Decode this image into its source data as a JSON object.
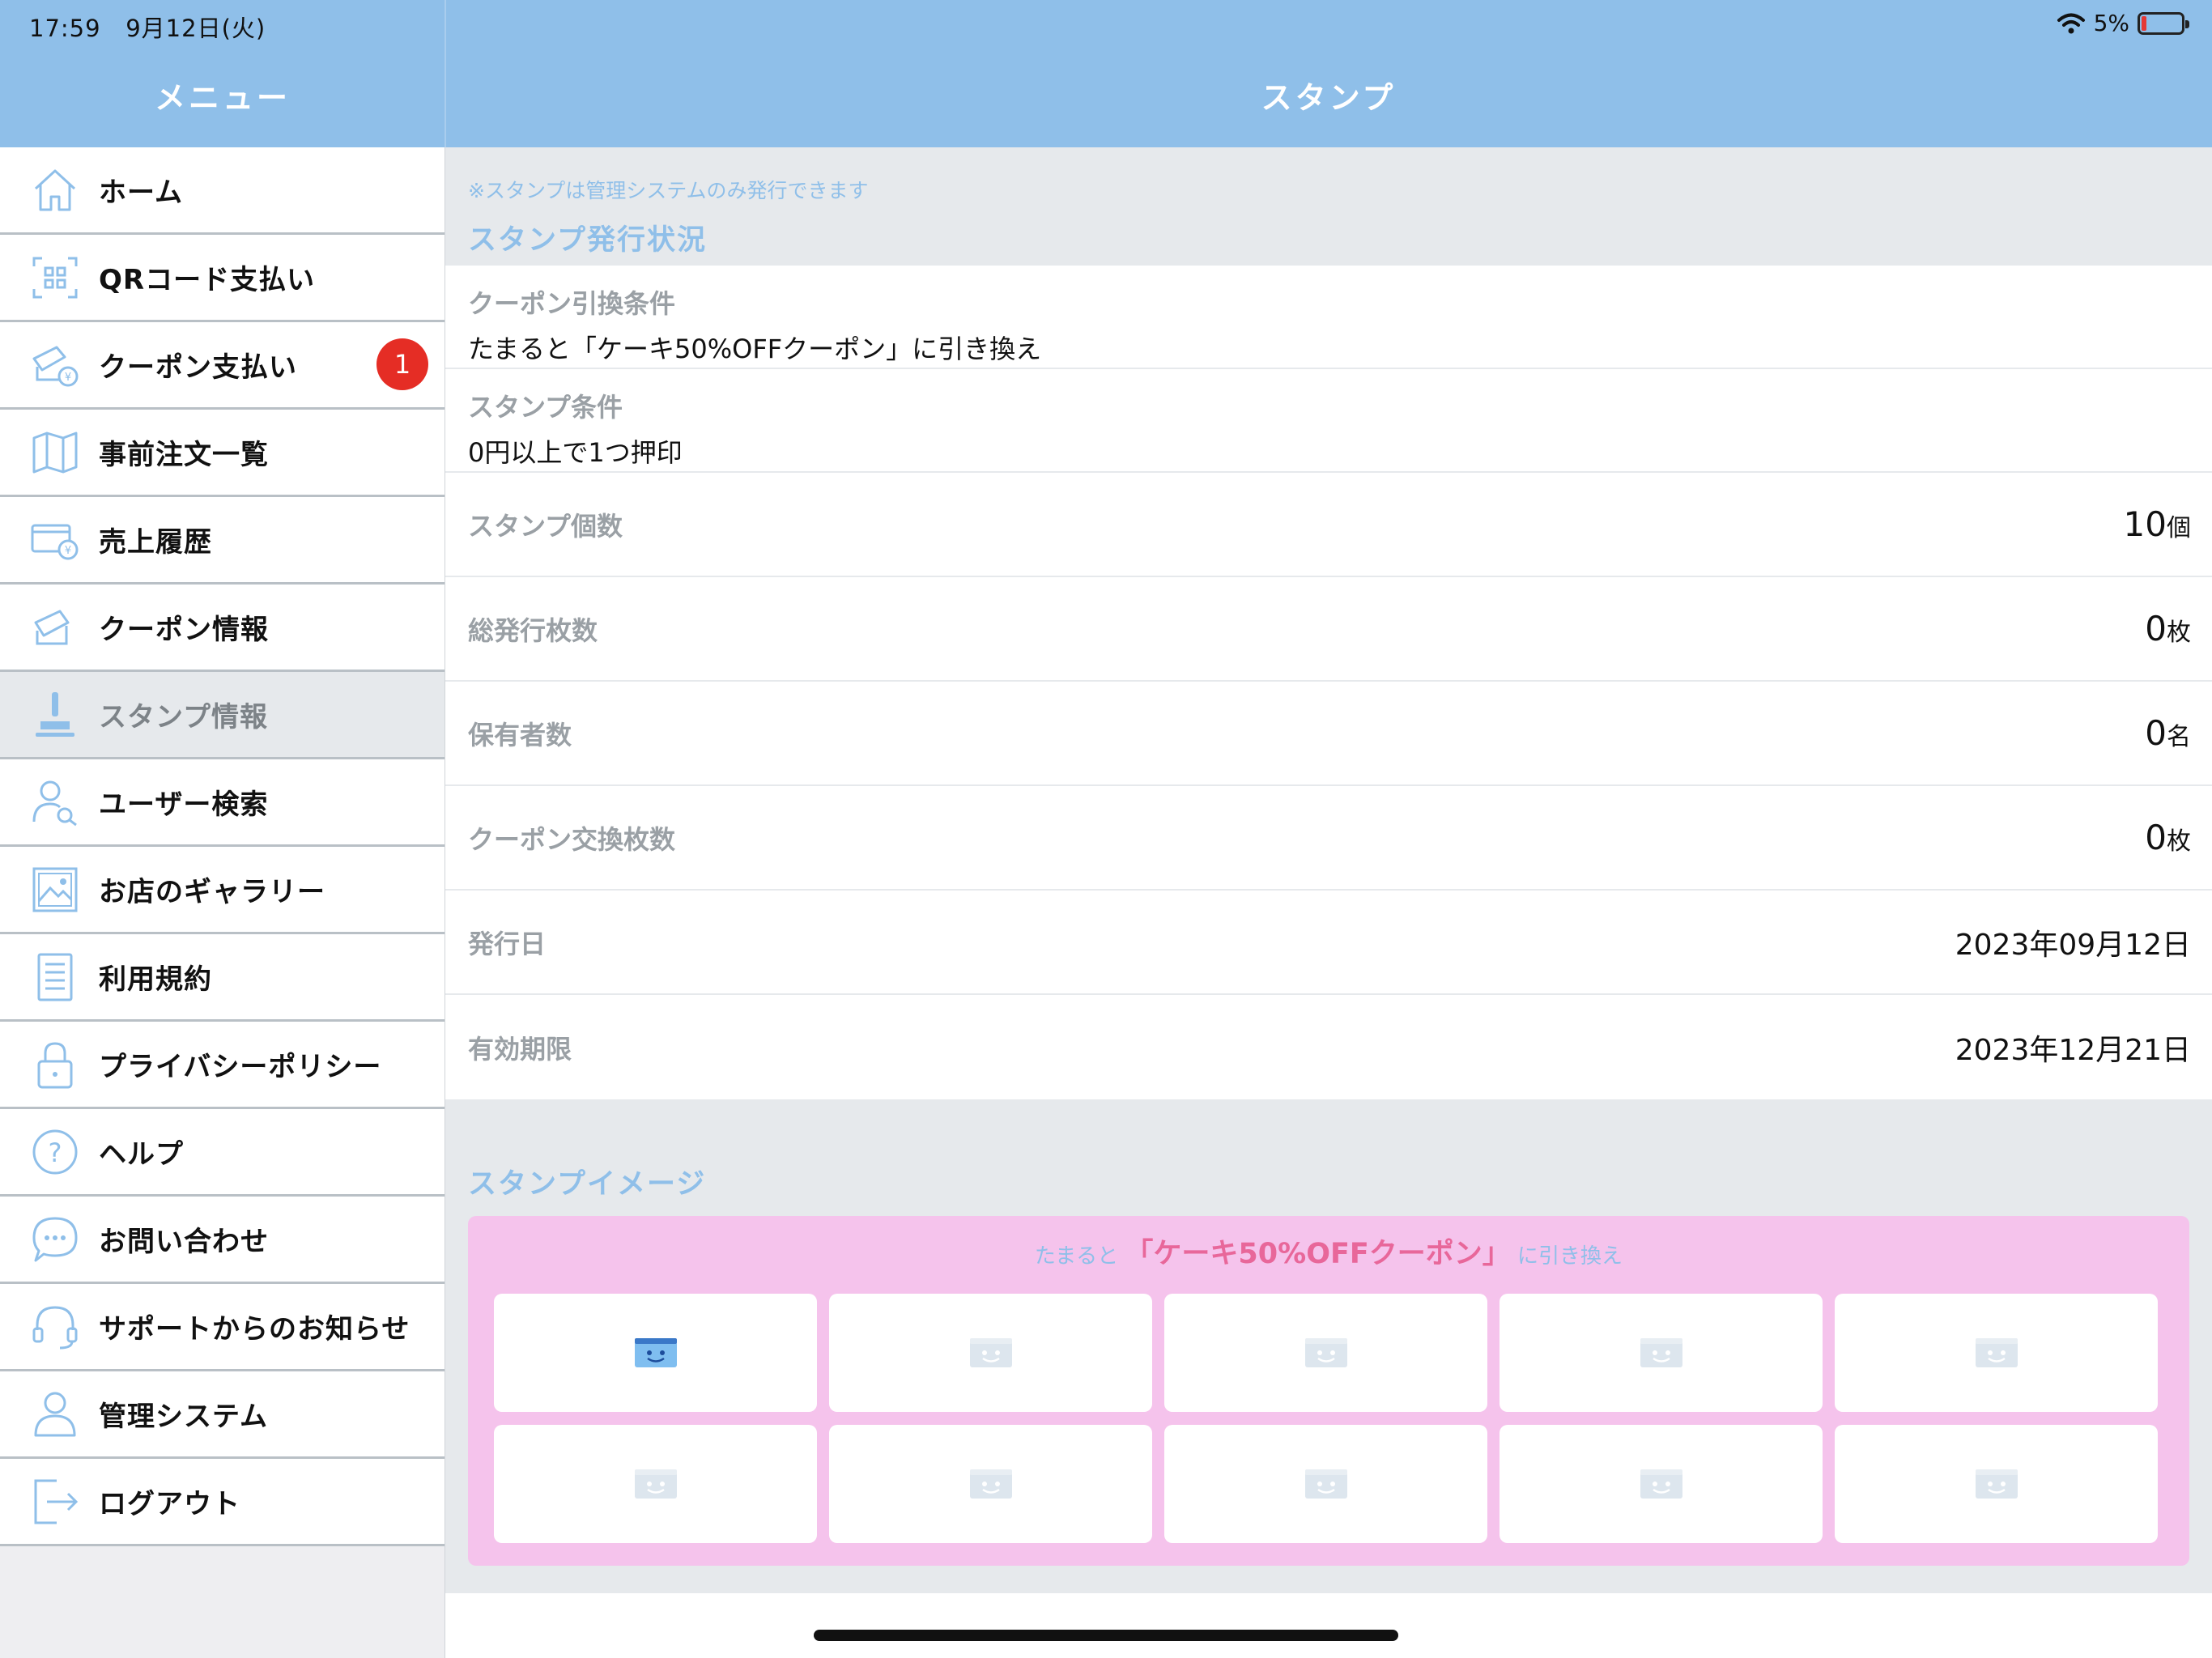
{
  "status_bar": {
    "time": "17:59",
    "date": "9月12日(火)",
    "battery": "5%"
  },
  "sidebar": {
    "title": "メニュー",
    "items": [
      {
        "label": "ホーム",
        "icon": "home-icon"
      },
      {
        "label": "QRコード支払い",
        "icon": "qr-scan-icon"
      },
      {
        "label": "クーポン支払い",
        "icon": "coupon-pay-icon",
        "badge": "1"
      },
      {
        "label": "事前注文一覧",
        "icon": "map-icon"
      },
      {
        "label": "売上履歴",
        "icon": "card-yen-icon"
      },
      {
        "label": "クーポン情報",
        "icon": "coupon-icon"
      },
      {
        "label": "スタンプ情報",
        "icon": "stamp-icon",
        "active": true
      },
      {
        "label": "ユーザー検索",
        "icon": "user-search-icon"
      },
      {
        "label": "お店のギャラリー",
        "icon": "gallery-icon"
      },
      {
        "label": "利用規約",
        "icon": "document-icon"
      },
      {
        "label": "プライバシーポリシー",
        "icon": "lock-icon"
      },
      {
        "label": "ヘルプ",
        "icon": "help-icon"
      },
      {
        "label": "お問い合わせ",
        "icon": "chat-icon"
      },
      {
        "label": "サポートからのお知らせ",
        "icon": "headset-icon"
      },
      {
        "label": "管理システム",
        "icon": "user-icon"
      },
      {
        "label": "ログアウト",
        "icon": "logout-icon"
      }
    ]
  },
  "header": {
    "title": "スタンプ"
  },
  "main": {
    "note": "※スタンプは管理システムのみ発行できます",
    "issue_section_title": "スタンプ発行状況",
    "coupon_condition_label": "クーポン引換条件",
    "coupon_condition_value": "たまると「ケーキ50%OFFクーポン」に引き換え",
    "stamp_condition_label": "スタンプ条件",
    "stamp_condition_value": "0円以上で1つ押印",
    "rows": [
      {
        "label": "スタンプ個数",
        "value": "10",
        "unit": "個"
      },
      {
        "label": "総発行枚数",
        "value": "0",
        "unit": "枚"
      },
      {
        "label": "保有者数",
        "value": "0",
        "unit": "名"
      },
      {
        "label": "クーポン交換枚数",
        "value": "0",
        "unit": "枚"
      },
      {
        "label": "発行日",
        "value": "2023年09月12日",
        "unit": ""
      },
      {
        "label": "有効期限",
        "value": "2023年12月21日",
        "unit": ""
      }
    ],
    "image_section_title": "スタンプイメージ",
    "stamp_caption_prefix": "たまると",
    "stamp_caption_highlight": "「ケーキ50%OFFクーポン」",
    "stamp_caption_suffix": "に引き換え",
    "stamp_total": 10,
    "stamp_filled": 1
  },
  "colors": {
    "header": "#8fbfe9",
    "accent_text": "#8fbfe9",
    "badge": "#e52d25",
    "stamp_card": "#f5c3ec",
    "stamp_highlight": "#e8679a"
  }
}
